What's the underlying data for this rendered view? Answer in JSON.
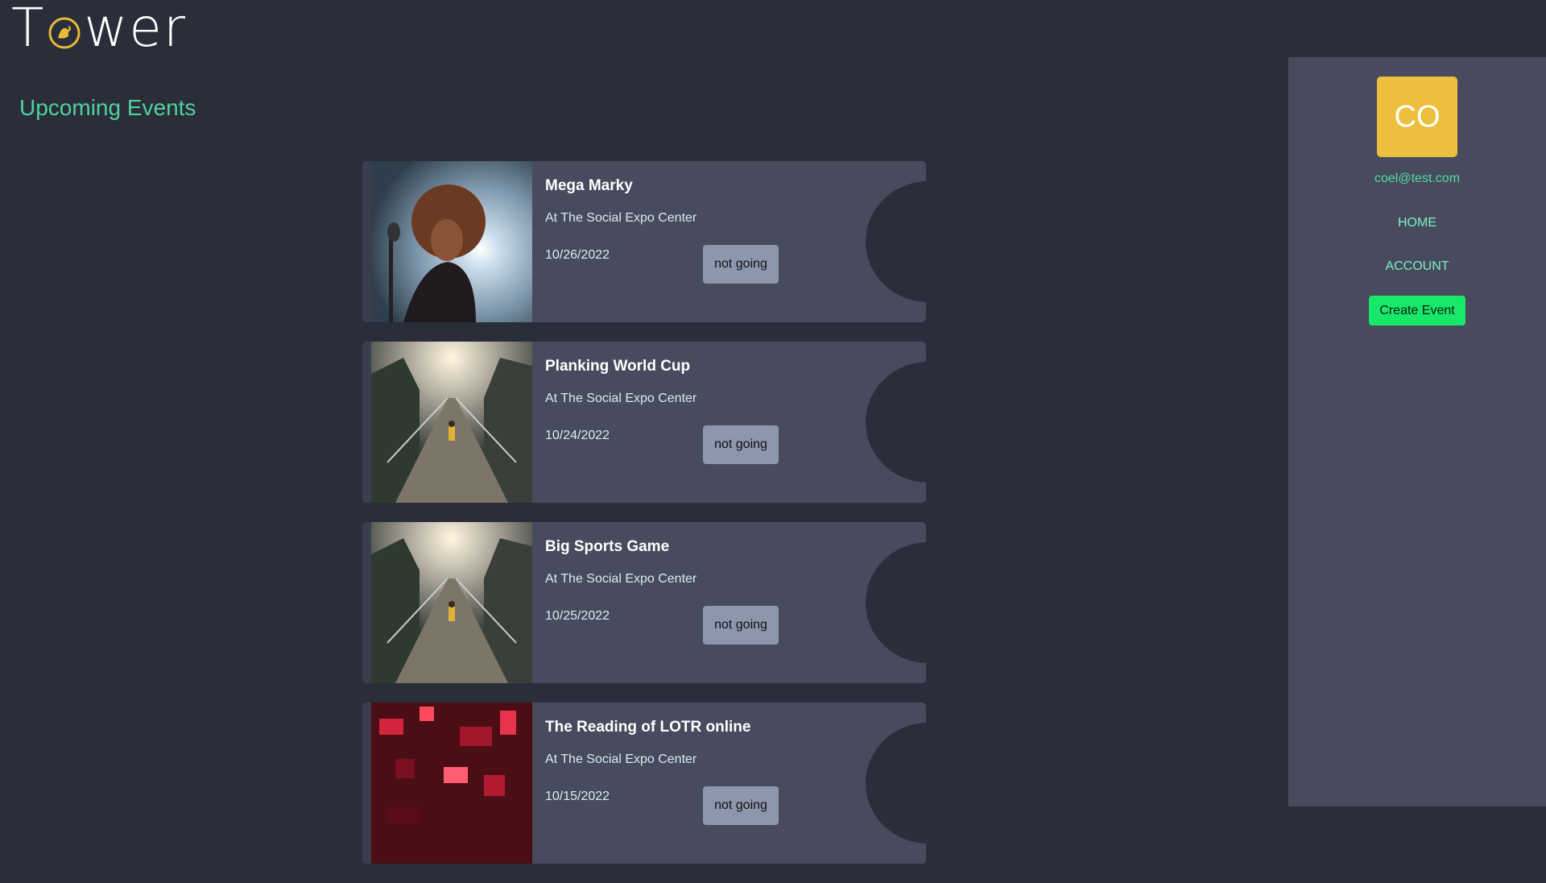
{
  "header": {
    "logo_prefix": "T",
    "logo_suffix": "wer",
    "logo_icon": "bird-seal-icon"
  },
  "main": {
    "title": "Upcoming Events",
    "events": [
      {
        "name": "Mega Marky",
        "location": "At The Social Expo Center",
        "date": "10/26/2022",
        "rsvp_label": "not going",
        "image": "singer-photo"
      },
      {
        "name": "Planking World Cup",
        "location": "At The Social Expo Center",
        "date": "10/24/2022",
        "rsvp_label": "not going",
        "image": "suspension-bridge-photo"
      },
      {
        "name": "Big Sports Game",
        "location": "At The Social Expo Center",
        "date": "10/25/2022",
        "rsvp_label": "not going",
        "image": "suspension-bridge-photo"
      },
      {
        "name": "The Reading of LOTR online",
        "location": "At The Social Expo Center",
        "date": "10/15/2022",
        "rsvp_label": "not going",
        "image": "red-circuit-photo"
      }
    ]
  },
  "sidebar": {
    "avatar_initials": "CO",
    "email": "coel@test.com",
    "nav": {
      "home": "HOME",
      "account": "ACCOUNT"
    },
    "create_event_label": "Create Event"
  },
  "colors": {
    "background": "#2a2d3a",
    "panel": "#474b5d",
    "accent_green": "#4fd39a",
    "button_green": "#17e86a",
    "avatar_yellow": "#ecc03c",
    "rsvp_button": "#8c96ad"
  }
}
